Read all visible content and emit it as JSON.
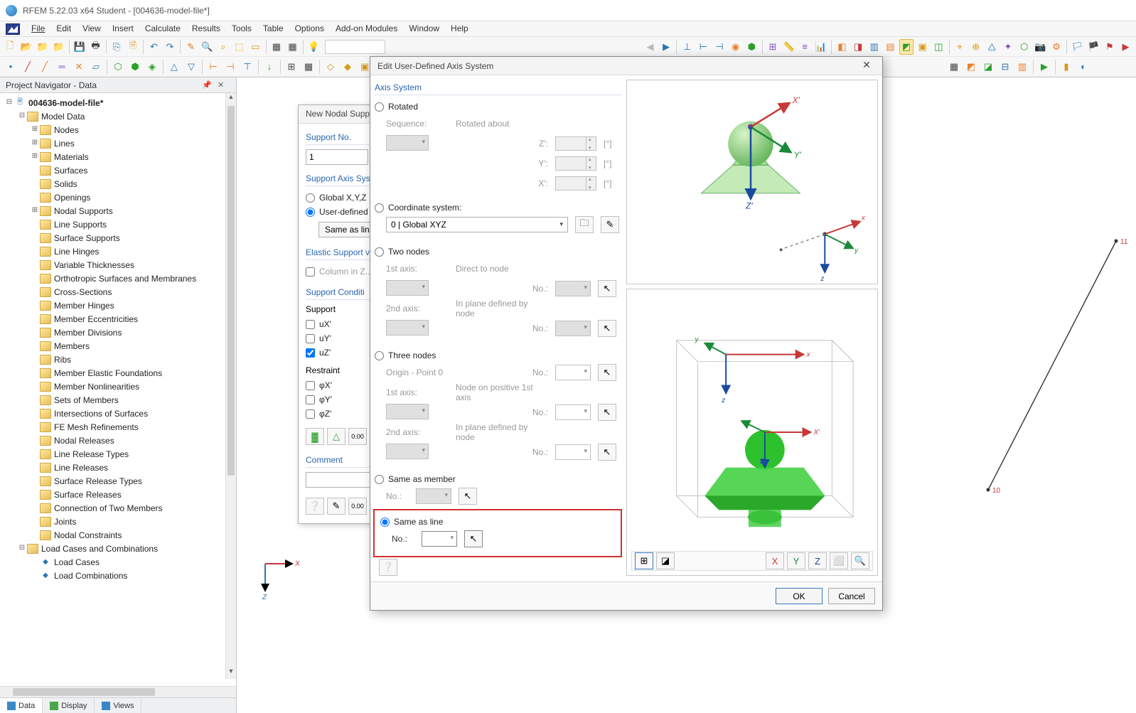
{
  "window": {
    "title": "RFEM 5.22.03 x64 Student - [004636-model-file*]"
  },
  "menu": [
    "File",
    "Edit",
    "View",
    "Insert",
    "Calculate",
    "Results",
    "Tools",
    "Table",
    "Options",
    "Add-on Modules",
    "Window",
    "Help"
  ],
  "navigator": {
    "title": "Project Navigator - Data",
    "root": "004636-model-file*",
    "modelData": "Model Data",
    "items": [
      "Nodes",
      "Lines",
      "Materials",
      "Surfaces",
      "Solids",
      "Openings",
      "Nodal Supports",
      "Line Supports",
      "Surface Supports",
      "Line Hinges",
      "Variable Thicknesses",
      "Orthotropic Surfaces and Membranes",
      "Cross-Sections",
      "Member Hinges",
      "Member Eccentricities",
      "Member Divisions",
      "Members",
      "Ribs",
      "Member Elastic Foundations",
      "Member Nonlinearities",
      "Sets of Members",
      "Intersections of Surfaces",
      "FE Mesh Refinements",
      "Nodal Releases",
      "Line Release Types",
      "Line Releases",
      "Surface Release Types",
      "Surface Releases",
      "Connection of Two Members",
      "Joints",
      "Nodal Constraints"
    ],
    "loadCasesGroup": "Load Cases and Combinations",
    "loadCases": [
      "Load Cases",
      "Load Combinations"
    ],
    "tabs": [
      "Data",
      "Display",
      "Views"
    ]
  },
  "supportDlg": {
    "title": "New Nodal Supp",
    "supportNoLabel": "Support No.",
    "supportNoValue": "1",
    "axisSection": "Support Axis Sys",
    "globalOpt": "Global X,Y,Z",
    "userOpt": "User-defined a",
    "sameAsLineBtn": "Same as line",
    "elasticSection": "Elastic Support v",
    "columnOpt": "Column in Z...",
    "condSection": "Support Conditi",
    "supportLabel": "Support",
    "ux": "uX'",
    "uy": "uY'",
    "uz": "uZ'",
    "restraintLabel": "Restraint",
    "phix": "φX'",
    "phiy": "φY'",
    "phiz": "φZ'",
    "commentSection": "Comment"
  },
  "axisDlg": {
    "title": "Edit User-Defined Axis System",
    "section": "Axis System",
    "rotated": "Rotated",
    "sequence": "Sequence:",
    "rotatedAbout": "Rotated about",
    "zprime": "Z':",
    "yprime": "Y':",
    "xprime": "X':",
    "deg": "[°]",
    "coordSystem": "Coordinate system:",
    "coordValue": "0  |  Global XYZ",
    "twoNodes": "Two nodes",
    "firstAxis": "1st axis:",
    "directToNode": "Direct to node",
    "no": "No.:",
    "secondAxis": "2nd axis:",
    "inPlaneNode": "In plane defined by node",
    "threeNodes": "Three nodes",
    "originPoint": "Origin - Point 0",
    "nodeOnPos": "Node on positive 1st axis",
    "sameAsMember": "Same as member",
    "sameAsLine": "Same as line",
    "ok": "OK",
    "cancel": "Cancel"
  },
  "canvas": {
    "node10": "10",
    "node11": "11"
  }
}
